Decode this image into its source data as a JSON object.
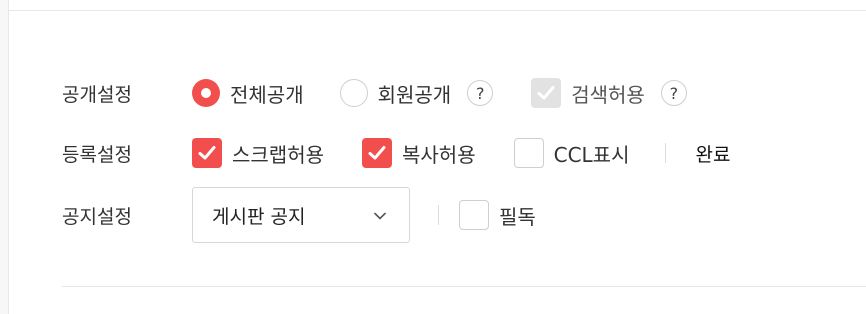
{
  "visibility": {
    "label": "공개설정",
    "options": [
      {
        "label": "전체공개",
        "selected": true
      },
      {
        "label": "회원공개",
        "selected": false
      }
    ],
    "help1": "?",
    "search_allow": {
      "label": "검색허용",
      "checked": true,
      "disabled": true
    },
    "help2": "?"
  },
  "registration": {
    "label": "등록설정",
    "scrap": {
      "label": "스크랩허용",
      "checked": true
    },
    "copy": {
      "label": "복사허용",
      "checked": true
    },
    "ccl": {
      "label": "CCL표시",
      "checked": false
    },
    "done_label": "완료"
  },
  "notice": {
    "label": "공지설정",
    "select_value": "게시판 공지",
    "must_read": {
      "label": "필독",
      "checked": false
    }
  },
  "colors": {
    "accent": "#f24e4e",
    "disabled": "#e2e2e2",
    "border": "#cfcfcf"
  },
  "icons": [
    "check-icon",
    "chevron-down-icon",
    "help-icon"
  ]
}
